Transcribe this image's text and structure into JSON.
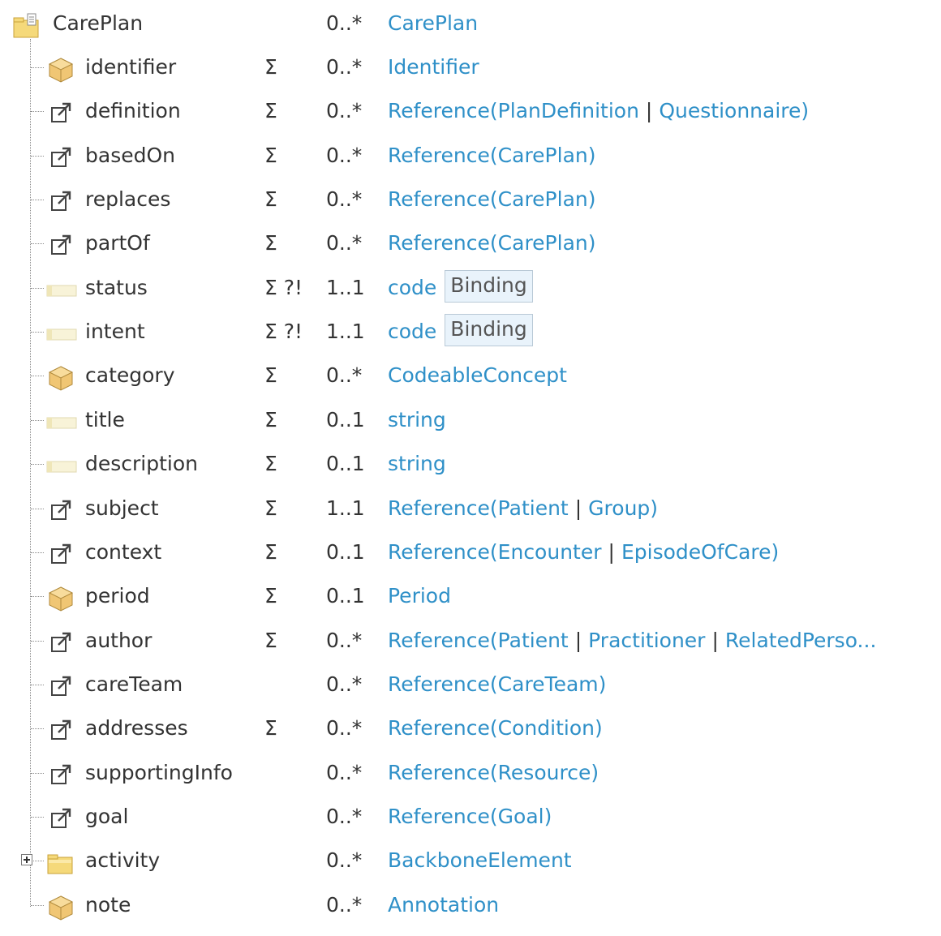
{
  "root": {
    "name": "CarePlan",
    "card": "0..*",
    "type": "CarePlan",
    "icon": "resource-folder-icon"
  },
  "elements": [
    {
      "name": "identifier",
      "flags": "Σ",
      "card": "0..*",
      "icon": "datatype-cube-icon",
      "type_parts": [
        {
          "t": "link",
          "v": "Identifier"
        }
      ]
    },
    {
      "name": "definition",
      "flags": "Σ",
      "card": "0..*",
      "icon": "reference-icon",
      "type_parts": [
        {
          "t": "link",
          "v": "Reference"
        },
        {
          "t": "text",
          "v": "("
        },
        {
          "t": "link",
          "v": "PlanDefinition"
        },
        {
          "t": "pipe",
          "v": "|"
        },
        {
          "t": "link",
          "v": "Questionnaire"
        },
        {
          "t": "text",
          "v": ")"
        }
      ]
    },
    {
      "name": "basedOn",
      "flags": "Σ",
      "card": "0..*",
      "icon": "reference-icon",
      "type_parts": [
        {
          "t": "link",
          "v": "Reference"
        },
        {
          "t": "text",
          "v": "("
        },
        {
          "t": "link",
          "v": "CarePlan"
        },
        {
          "t": "text",
          "v": ")"
        }
      ]
    },
    {
      "name": "replaces",
      "flags": "Σ",
      "card": "0..*",
      "icon": "reference-icon",
      "type_parts": [
        {
          "t": "link",
          "v": "Reference"
        },
        {
          "t": "text",
          "v": "("
        },
        {
          "t": "link",
          "v": "CarePlan"
        },
        {
          "t": "text",
          "v": ")"
        }
      ]
    },
    {
      "name": "partOf",
      "flags": "Σ",
      "card": "0..*",
      "icon": "reference-icon",
      "type_parts": [
        {
          "t": "link",
          "v": "Reference"
        },
        {
          "t": "text",
          "v": "("
        },
        {
          "t": "link",
          "v": "CarePlan"
        },
        {
          "t": "text",
          "v": ")"
        }
      ]
    },
    {
      "name": "status",
      "flags": "Σ ?!",
      "card": "1..1",
      "icon": "primitive-icon",
      "type_parts": [
        {
          "t": "link",
          "v": "code"
        },
        {
          "t": "binding",
          "v": "Binding"
        }
      ]
    },
    {
      "name": "intent",
      "flags": "Σ ?!",
      "card": "1..1",
      "icon": "primitive-icon",
      "type_parts": [
        {
          "t": "link",
          "v": "code"
        },
        {
          "t": "binding",
          "v": "Binding"
        }
      ]
    },
    {
      "name": "category",
      "flags": "Σ",
      "card": "0..*",
      "icon": "datatype-cube-icon",
      "type_parts": [
        {
          "t": "link",
          "v": "CodeableConcept"
        }
      ]
    },
    {
      "name": "title",
      "flags": "Σ",
      "card": "0..1",
      "icon": "primitive-icon",
      "type_parts": [
        {
          "t": "link",
          "v": "string"
        }
      ]
    },
    {
      "name": "description",
      "flags": "Σ",
      "card": "0..1",
      "icon": "primitive-icon",
      "type_parts": [
        {
          "t": "link",
          "v": "string"
        }
      ]
    },
    {
      "name": "subject",
      "flags": "Σ",
      "card": "1..1",
      "icon": "reference-icon",
      "type_parts": [
        {
          "t": "link",
          "v": "Reference"
        },
        {
          "t": "text",
          "v": "("
        },
        {
          "t": "link",
          "v": "Patient"
        },
        {
          "t": "pipe",
          "v": "|"
        },
        {
          "t": "link",
          "v": "Group"
        },
        {
          "t": "text",
          "v": ")"
        }
      ]
    },
    {
      "name": "context",
      "flags": "Σ",
      "card": "0..1",
      "icon": "reference-icon",
      "type_parts": [
        {
          "t": "link",
          "v": "Reference"
        },
        {
          "t": "text",
          "v": "("
        },
        {
          "t": "link",
          "v": "Encounter"
        },
        {
          "t": "pipe",
          "v": "|"
        },
        {
          "t": "link",
          "v": "EpisodeOfCare"
        },
        {
          "t": "text",
          "v": ")"
        }
      ]
    },
    {
      "name": "period",
      "flags": "Σ",
      "card": "0..1",
      "icon": "datatype-cube-icon",
      "type_parts": [
        {
          "t": "link",
          "v": "Period"
        }
      ]
    },
    {
      "name": "author",
      "flags": "Σ",
      "card": "0..*",
      "icon": "reference-icon",
      "type_parts": [
        {
          "t": "link",
          "v": "Reference"
        },
        {
          "t": "text",
          "v": "("
        },
        {
          "t": "link",
          "v": "Patient"
        },
        {
          "t": "pipe",
          "v": "|"
        },
        {
          "t": "link",
          "v": "Practitioner"
        },
        {
          "t": "pipe",
          "v": "|"
        },
        {
          "t": "link",
          "v": "RelatedPerso..."
        }
      ]
    },
    {
      "name": "careTeam",
      "flags": "",
      "card": "0..*",
      "icon": "reference-icon",
      "type_parts": [
        {
          "t": "link",
          "v": "Reference"
        },
        {
          "t": "text",
          "v": "("
        },
        {
          "t": "link",
          "v": "CareTeam"
        },
        {
          "t": "text",
          "v": ")"
        }
      ]
    },
    {
      "name": "addresses",
      "flags": "Σ",
      "card": "0..*",
      "icon": "reference-icon",
      "type_parts": [
        {
          "t": "link",
          "v": "Reference"
        },
        {
          "t": "text",
          "v": "("
        },
        {
          "t": "link",
          "v": "Condition"
        },
        {
          "t": "text",
          "v": ")"
        }
      ]
    },
    {
      "name": "supportingInfo",
      "flags": "",
      "card": "0..*",
      "icon": "reference-icon",
      "type_parts": [
        {
          "t": "link",
          "v": "Reference"
        },
        {
          "t": "text",
          "v": "("
        },
        {
          "t": "link",
          "v": "Resource"
        },
        {
          "t": "text",
          "v": ")"
        }
      ]
    },
    {
      "name": "goal",
      "flags": "",
      "card": "0..*",
      "icon": "reference-icon",
      "type_parts": [
        {
          "t": "link",
          "v": "Reference"
        },
        {
          "t": "text",
          "v": "("
        },
        {
          "t": "link",
          "v": "Goal"
        },
        {
          "t": "text",
          "v": ")"
        }
      ]
    },
    {
      "name": "activity",
      "flags": "",
      "card": "0..*",
      "icon": "element-folder-icon",
      "expandable": true,
      "type_parts": [
        {
          "t": "link",
          "v": "BackboneElement"
        }
      ]
    },
    {
      "name": "note",
      "flags": "",
      "card": "0..*",
      "icon": "datatype-cube-icon",
      "type_parts": [
        {
          "t": "link",
          "v": "Annotation"
        }
      ]
    }
  ]
}
